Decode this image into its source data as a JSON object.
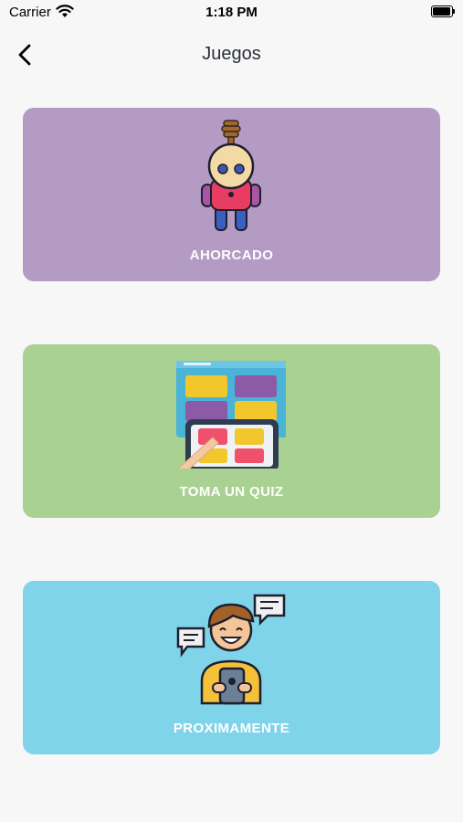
{
  "status_bar": {
    "carrier": "Carrier",
    "time": "1:18 PM"
  },
  "nav": {
    "title": "Juegos",
    "back_icon": "chevron-left-icon"
  },
  "cards": [
    {
      "label": "AHORCADO",
      "color": "#b39bc4",
      "icon": "hanged-doll-icon"
    },
    {
      "label": "TOMA UN QUIZ",
      "color": "#a9d192",
      "icon": "quiz-tablet-icon"
    },
    {
      "label": "PROXIMAMENTE",
      "color": "#80d4e9",
      "icon": "chat-person-icon"
    }
  ]
}
